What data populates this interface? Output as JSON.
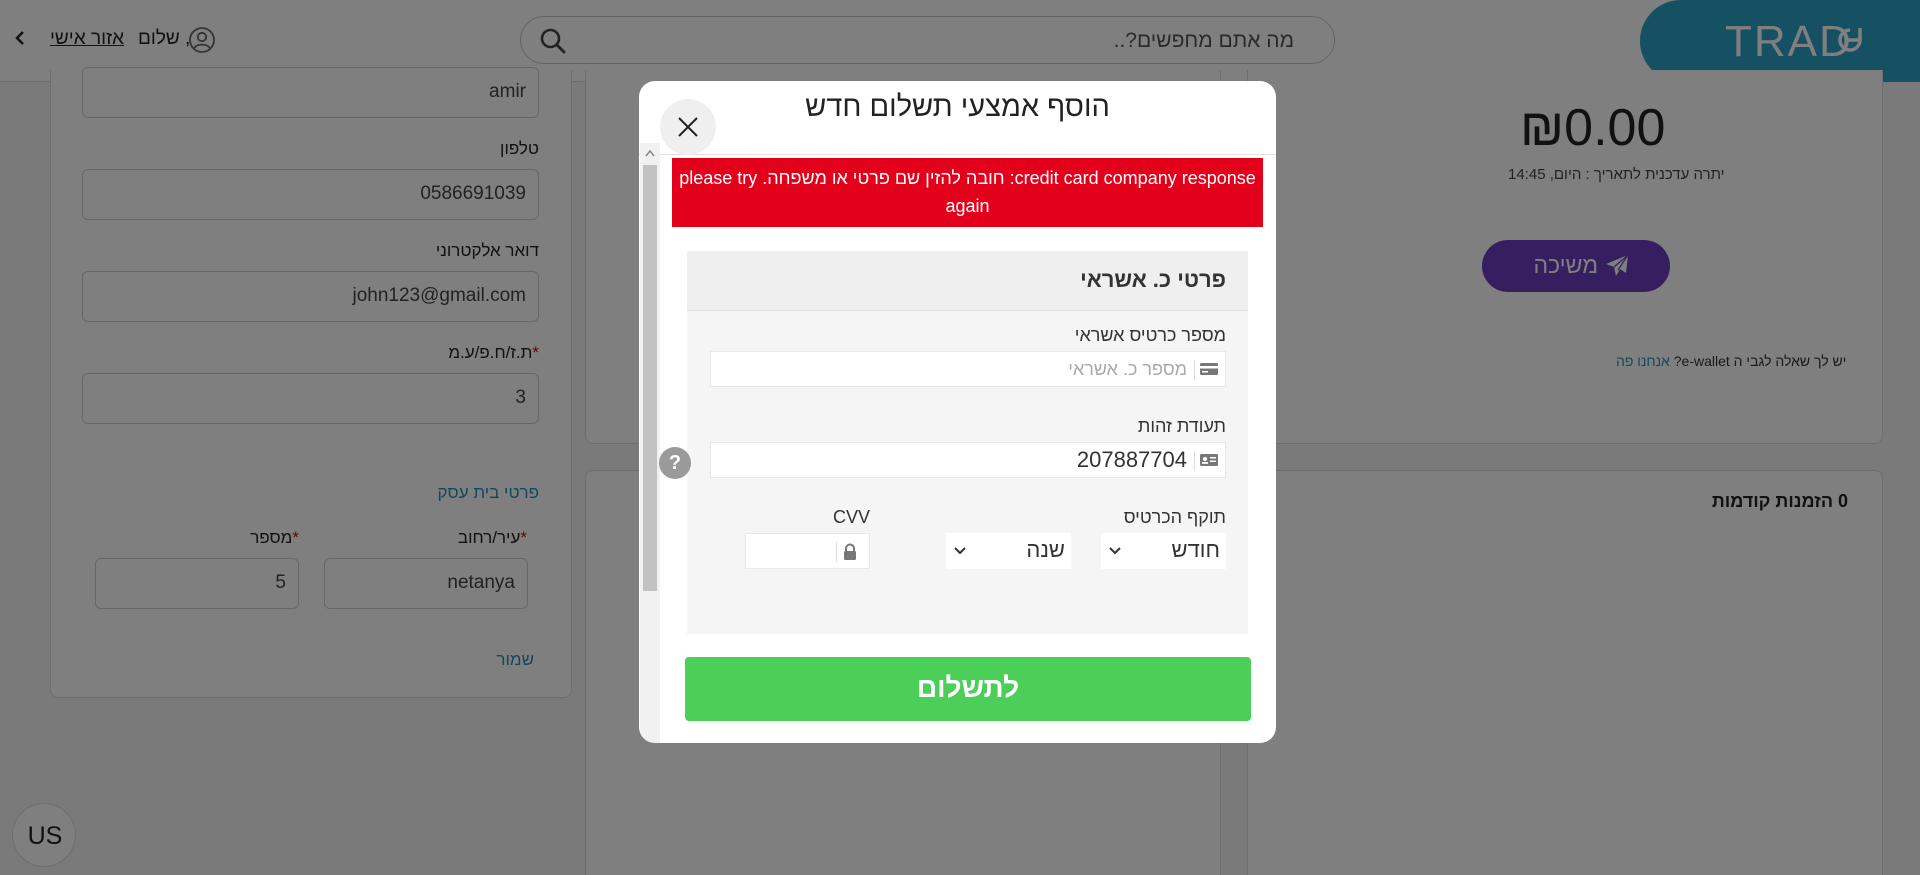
{
  "header": {
    "logo_text": "TRAD",
    "logo_mark_icon": "refresh-arrow-icon",
    "search_placeholder": "מה אתם מחפשים?..",
    "personal_area": "אזור אישי",
    "greeting": "שלום ,"
  },
  "profile": {
    "name_value": "amir",
    "phone_label": "טלפון",
    "phone_value": "0586691039",
    "email_label": "דואר אלקטרוני",
    "email_value": "john123@gmail.com",
    "id_label": "ת.ז/ח.פ/ע.מ",
    "id_required_mark": "*",
    "id_value": "3",
    "business_details_link": "פרטי בית עסק",
    "city_label": "עיר/רחוב",
    "city_required_mark": "*",
    "city_value": "netanya",
    "number_label": "מספר",
    "number_required_mark": "*",
    "number_value": "5",
    "save_link": "שמור"
  },
  "wallet": {
    "balance": "₪0.00",
    "balance_date": "יתרה עדכנית לתאריך : היום, 14:45",
    "withdraw_label": "משיכה",
    "question_text": "יש לך שאלה לגבי ה e-wallet? ",
    "question_link": "אנחנו פה"
  },
  "orders": {
    "title": "0 הזמנות קודמות"
  },
  "language": {
    "code": "US"
  },
  "modal": {
    "title": "הוסף אמצעי תשלום חדש",
    "error_message": "credit card company response: חובה להזין שם פרטי או משפחה. please try again",
    "panel_title": "פרטי כ. אשראי",
    "card_number_label": "מספר כרטיס אשראי",
    "card_number_placeholder": "מספר כ. אשראי",
    "id_label": "תעודת זהות",
    "id_value": "207887704",
    "expiry_label": "תוקף הכרטיס",
    "month_value": "חודש",
    "year_value": "שנה",
    "cvv_label": "CVV",
    "help_symbol": "?",
    "pay_label": "לתשלום"
  },
  "colors": {
    "brand": "#2aa1c6",
    "withdraw": "#6b3fc2",
    "error": "#e3001b",
    "pay": "#4ccf58",
    "link": "#2a8fb5"
  }
}
